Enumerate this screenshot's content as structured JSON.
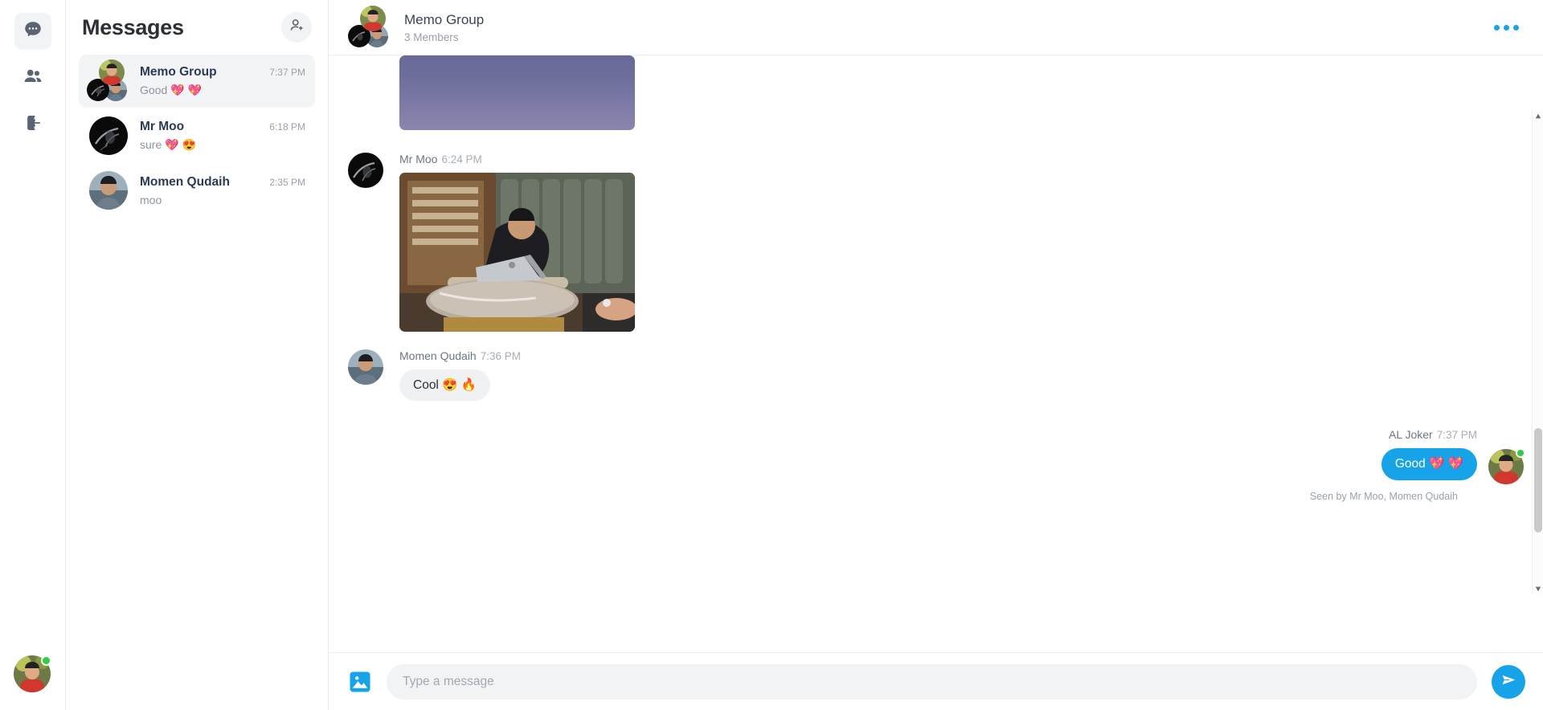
{
  "rail": {
    "items": [
      {
        "icon": "chat-bubble-icon",
        "name": "rail-item-chats",
        "active": true
      },
      {
        "icon": "people-icon",
        "name": "rail-item-contacts",
        "active": false
      },
      {
        "icon": "logout-icon",
        "name": "rail-item-logout",
        "active": false
      }
    ],
    "current_user": {
      "name": "AL Joker",
      "status": "online",
      "status_color": "#2fcc45"
    }
  },
  "sidebar": {
    "title": "Messages",
    "new_chat_icon": "add-person-icon",
    "conversations": [
      {
        "name": "Memo Group",
        "time": "7:37 PM",
        "last_message": "Good 💖 💖",
        "selected": true,
        "is_group": true
      },
      {
        "name": "Mr Moo",
        "time": "6:18 PM",
        "last_message": "sure 💖 😍",
        "selected": false,
        "is_group": false
      },
      {
        "name": "Momen Qudaih",
        "time": "2:35 PM",
        "last_message": "moo",
        "selected": false,
        "is_group": false
      }
    ]
  },
  "chat_header": {
    "title": "Memo Group",
    "subtitle": "3 Members",
    "menu_icon": "ellipsis-horizontal-icon"
  },
  "messages": [
    {
      "type": "image",
      "direction": "in",
      "sender": "",
      "time": "",
      "partial": true
    },
    {
      "type": "image",
      "direction": "in",
      "sender": "Mr Moo",
      "time": "6:24 PM"
    },
    {
      "type": "text",
      "direction": "in",
      "sender": "Momen Qudaih",
      "time": "7:36 PM",
      "text": "Cool 😍 🔥"
    },
    {
      "type": "text",
      "direction": "out",
      "sender": "AL Joker",
      "time": "7:37 PM",
      "text": "Good 💖 💖"
    }
  ],
  "seen_status": "Seen by Mr Moo, Momen Qudaih",
  "composer": {
    "image_icon": "image-attachment-icon",
    "placeholder": "Type a message",
    "value": "",
    "send_icon": "send-paper-plane-icon"
  },
  "colors": {
    "accent": "#17a3e8",
    "bubble_in": "#f0f1f3",
    "online": "#2fcc45",
    "text_primary": "#2b2f36",
    "text_muted": "#9aa1ab"
  }
}
